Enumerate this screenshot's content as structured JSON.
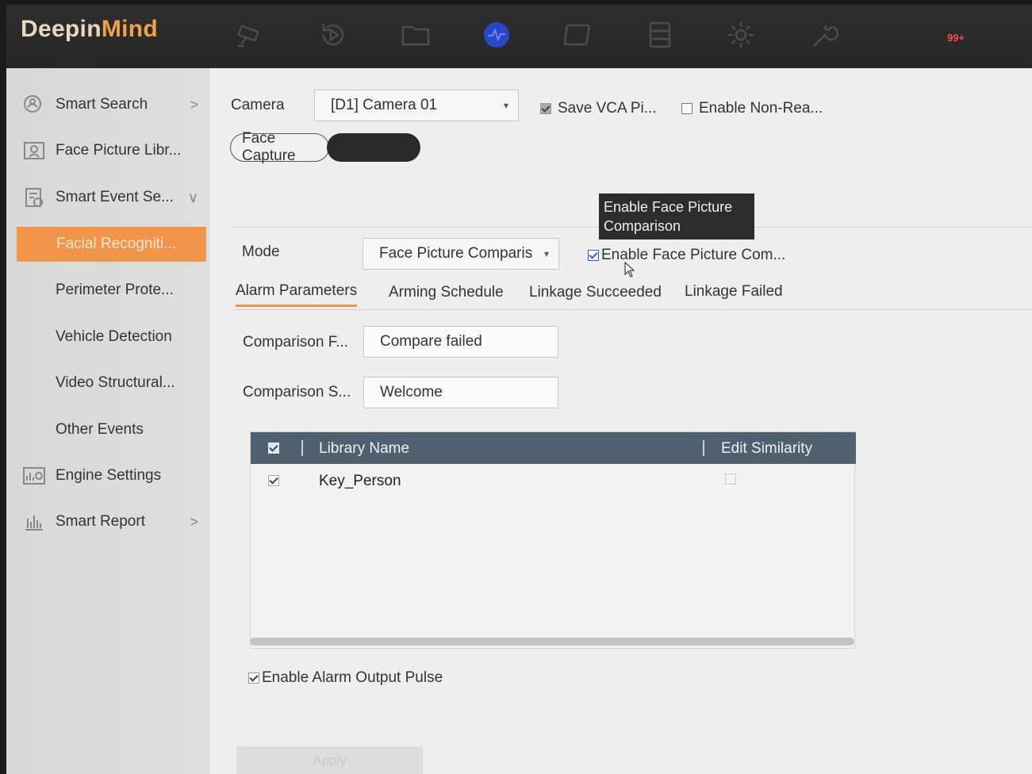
{
  "brand": {
    "part1": "Deepin",
    "part2": "Mind"
  },
  "topbar": {
    "icons": [
      "camera-icon",
      "playback-icon",
      "folder-icon",
      "smart-icon",
      "cloud-icon",
      "storage-icon",
      "gear-icon",
      "wrench-icon"
    ],
    "active_icon": "smart-icon",
    "alarm_badge": "99+",
    "accent": "#2848c8"
  },
  "sidebar": {
    "items": [
      {
        "label": "Smart Search",
        "icon": "search-icon",
        "chevron": ">"
      },
      {
        "label": "Face Picture Libr...",
        "icon": "face-library-icon"
      },
      {
        "label": "Smart Event Se...",
        "icon": "event-settings-icon",
        "chevron": "∨"
      },
      {
        "label": "Facial Recogniti...",
        "active": true
      },
      {
        "label": "Perimeter Prote..."
      },
      {
        "label": "Vehicle Detection"
      },
      {
        "label": "Video Structural..."
      },
      {
        "label": "Other Events"
      },
      {
        "label": "Engine Settings",
        "icon": "engine-icon"
      },
      {
        "label": "Smart Report",
        "icon": "report-icon",
        "chevron": ">"
      }
    ],
    "active_color": "#f0954a"
  },
  "main": {
    "camera_label": "Camera",
    "camera_value": "[D1] Camera 01",
    "save_vca_label": "Save VCA Pi...",
    "save_vca_checked": true,
    "enable_nonrea_label": "Enable Non-Rea...",
    "enable_nonrea_checked": false,
    "face_capture_label": "Face Capture",
    "tooltip": {
      "line1": "Enable Face Picture",
      "line2": "Comparison"
    },
    "mode_label": "Mode",
    "mode_value": "Face Picture Comparis",
    "enable_comparison_label": "Enable Face Picture Com...",
    "enable_comparison_checked": true,
    "tabs": [
      "Alarm Parameters",
      "Arming Schedule",
      "Linkage Succeeded",
      "Linkage Failed"
    ],
    "active_tab": "Alarm Parameters",
    "comparison_failed_label": "Comparison F...",
    "comparison_failed_value": "Compare failed",
    "comparison_success_label": "Comparison S...",
    "comparison_success_value": "Welcome",
    "table": {
      "columns": [
        "Library Name",
        "Edit Similarity"
      ],
      "rows": [
        {
          "name": "Key_Person",
          "checked": true
        }
      ]
    },
    "output_pulse_label": "Enable Alarm Output Pulse",
    "output_pulse_checked": true,
    "apply_label": "Apply"
  }
}
